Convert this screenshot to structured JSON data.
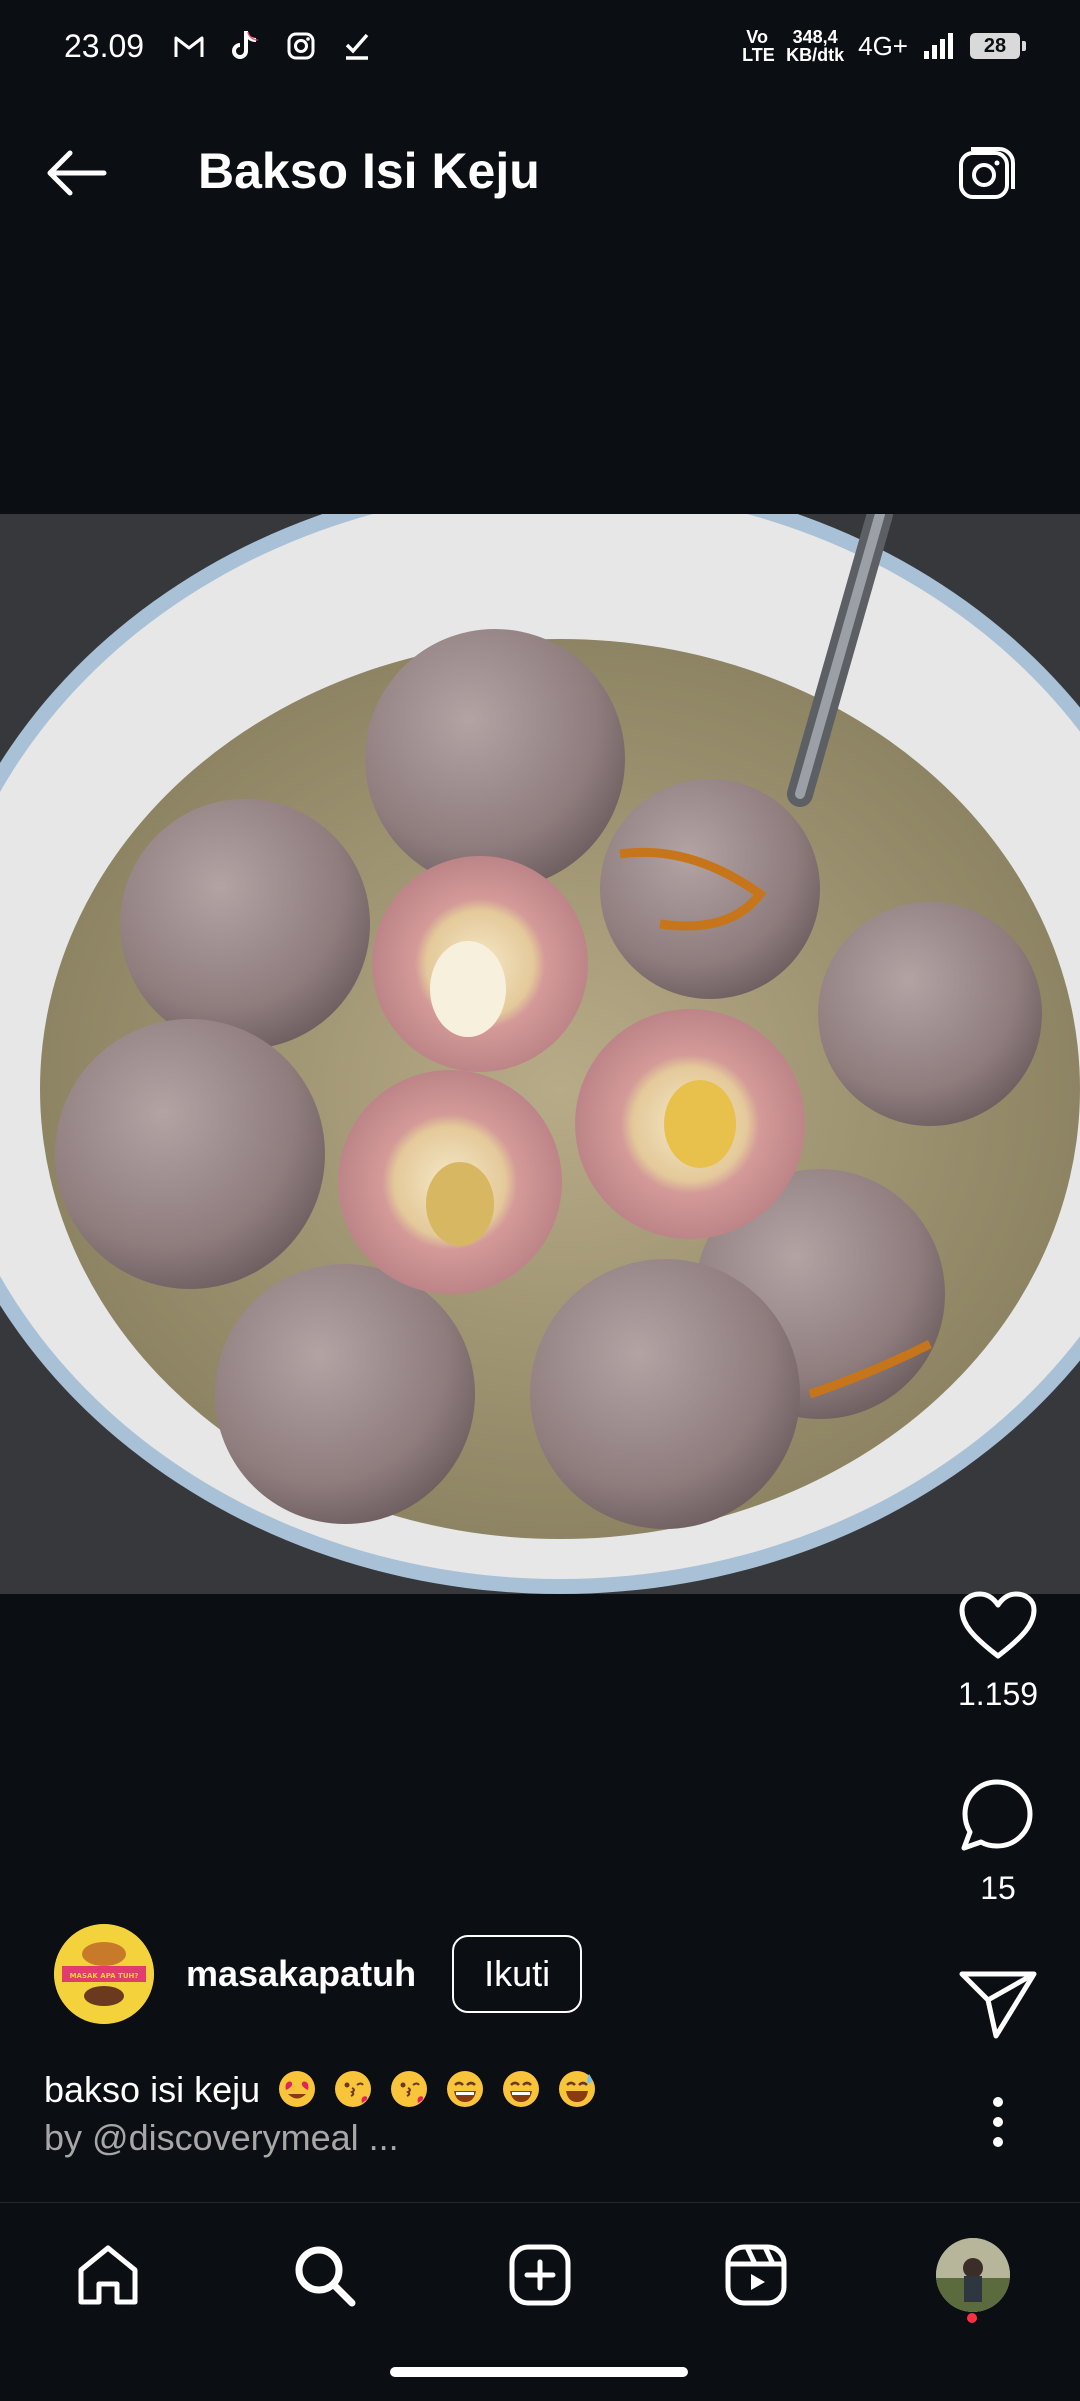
{
  "status_bar": {
    "time": "23.09",
    "icons": [
      "gmail-icon",
      "tiktok-icon",
      "instagram-icon",
      "check-icon"
    ],
    "volte": "Vo LTE",
    "speed_value": "348,4",
    "speed_unit": "KB/dtk",
    "network": "4G+",
    "battery": "28"
  },
  "header": {
    "title": "Bakso Isi Keju",
    "back_icon": "arrow-left-icon",
    "camera_icon": "camera-icon"
  },
  "post": {
    "image_description_icon": "meatball-soup-photo",
    "likes": "1.159",
    "comments": "15",
    "author": "masakapatuh",
    "follow_label": "Ikuti",
    "caption_text": "bakso isi keju",
    "caption_credit": "by @discoverymeal ...",
    "avatar_badge_text": "MASAK APA TUH?"
  },
  "nav": {
    "items": [
      "home-icon",
      "search-icon",
      "create-icon",
      "reels-icon",
      "profile-avatar"
    ]
  },
  "colors": {
    "background": "#0b0f14",
    "text": "#ffffff",
    "credit": "#a7a7a7",
    "notification_dot": "#ff3040"
  }
}
